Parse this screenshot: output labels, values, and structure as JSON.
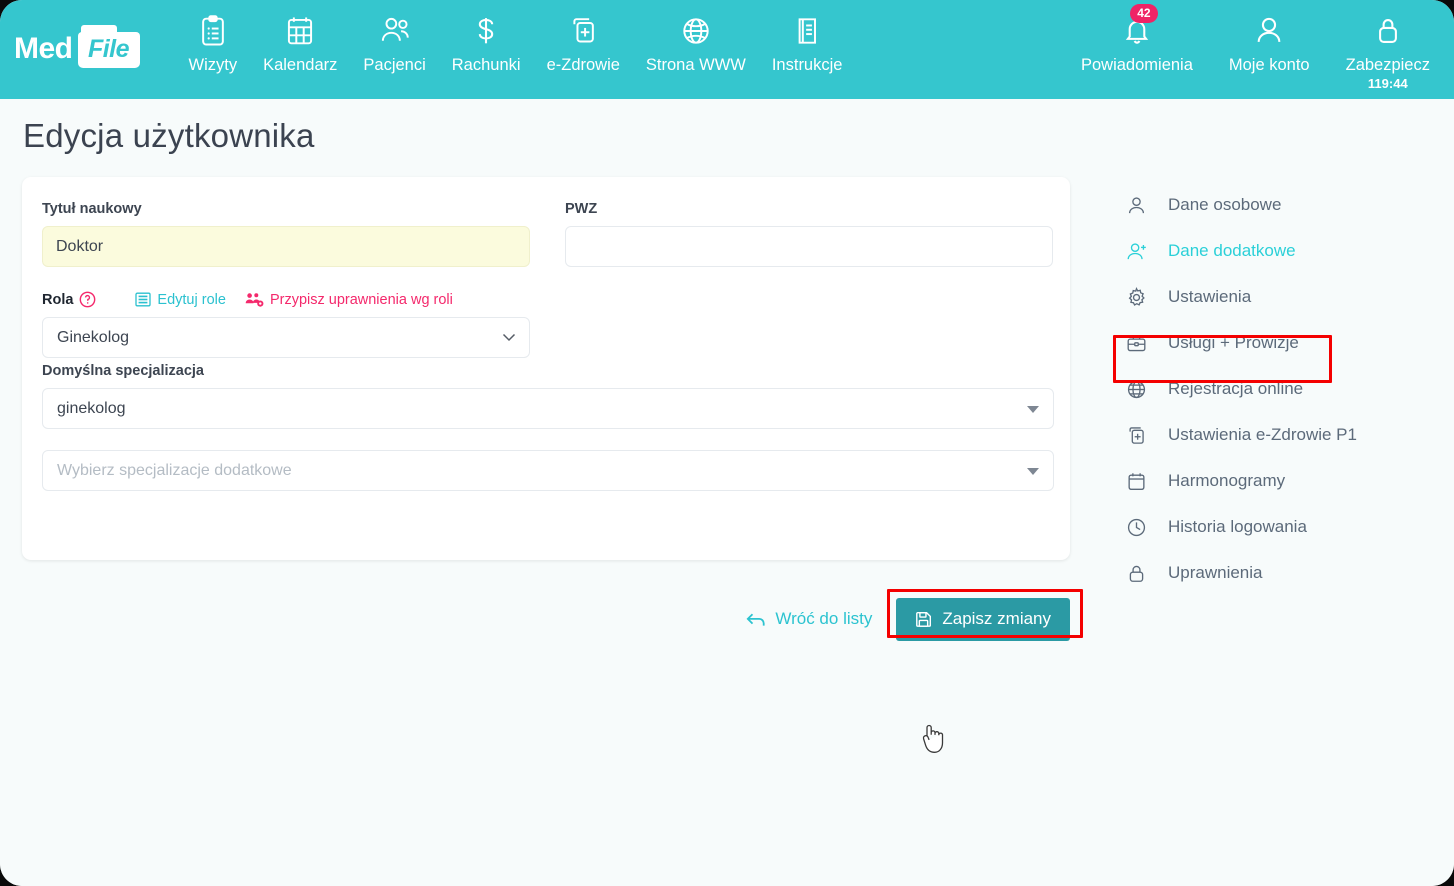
{
  "app": {
    "logo_primary": "Med",
    "logo_secondary": "File"
  },
  "topnav": {
    "items": [
      {
        "label": "Wizyty",
        "icon": "clipboard-icon"
      },
      {
        "label": "Kalendarz",
        "icon": "calendar-icon"
      },
      {
        "label": "Pacjenci",
        "icon": "users-icon"
      },
      {
        "label": "Rachunki",
        "icon": "dollar-icon"
      },
      {
        "label": "e-Zdrowie",
        "icon": "medical-card-icon"
      },
      {
        "label": "Strona WWW",
        "icon": "globe-icon"
      },
      {
        "label": "Instrukcje",
        "icon": "book-icon"
      }
    ],
    "right": {
      "notifications": {
        "label": "Powiadomienia",
        "badge": "42",
        "icon": "bell-icon"
      },
      "account": {
        "label": "Moje konto",
        "icon": "user-icon"
      },
      "secure": {
        "label": "Zabezpiecz",
        "timer": "119:44",
        "icon": "lock-icon"
      }
    }
  },
  "page": {
    "title": "Edycja użytkownika"
  },
  "form": {
    "academic_title": {
      "label": "Tytuł naukowy",
      "value": "Doktor",
      "placeholder": ""
    },
    "pwz": {
      "label": "PWZ",
      "value": "",
      "placeholder": ""
    },
    "role": {
      "label": "Rola",
      "help_icon": "question-mark-icon",
      "edit_roles_link": "Edytuj role",
      "assign_permissions_link": "Przypisz uprawnienia wg roli",
      "value": "Ginekolog"
    },
    "default_specialization": {
      "label": "Domyślna specjalizacja",
      "value": "ginekolog"
    },
    "additional_specializations": {
      "placeholder": "Wybierz specjalizacje dodatkowe",
      "value": ""
    }
  },
  "actions": {
    "back_label": "Wróć do listy",
    "save_label": "Zapisz zmiany"
  },
  "sidebar": {
    "items": [
      {
        "label": "Dane osobowe",
        "icon": "user-icon",
        "active": false
      },
      {
        "label": "Dane dodatkowe",
        "icon": "user-plus-icon",
        "active": true
      },
      {
        "label": "Ustawienia",
        "icon": "gear-icon",
        "active": false
      },
      {
        "label": "Usługi + Prowizje",
        "icon": "briefcase-icon",
        "active": false
      },
      {
        "label": "Rejestracja online",
        "icon": "globe-icon",
        "active": false
      },
      {
        "label": "Ustawienia e-Zdrowie P1",
        "icon": "medical-card-icon",
        "active": false
      },
      {
        "label": "Harmonogramy",
        "icon": "calendar-icon",
        "active": false
      },
      {
        "label": "Historia logowania",
        "icon": "clock-icon",
        "active": false
      },
      {
        "label": "Uprawnienia",
        "icon": "lock-icon",
        "active": false
      }
    ]
  },
  "colors": {
    "brand_teal": "#35c6ce",
    "accent_pink": "#f4296c",
    "link_teal": "#2bc1cf",
    "save_button": "#2b9aa4",
    "annotation_red": "#f40000",
    "autofill_yellow": "#fbfbdd",
    "page_background": "#f7fbfb"
  }
}
